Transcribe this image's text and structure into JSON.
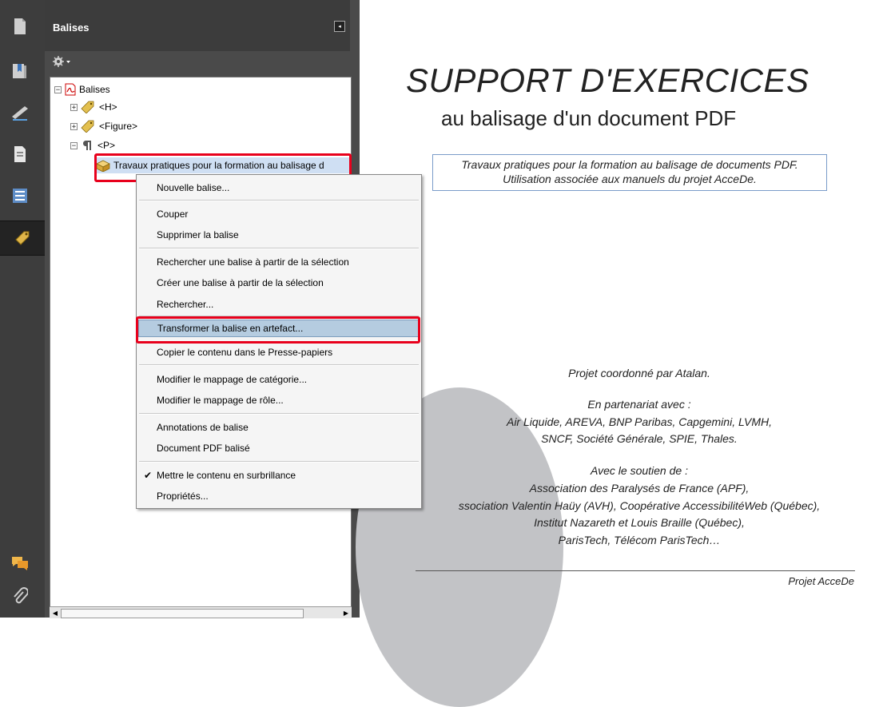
{
  "sidebar": {
    "tools": [
      {
        "name": "pages-icon"
      },
      {
        "name": "bookmarks-icon"
      },
      {
        "name": "signatures-icon"
      },
      {
        "name": "layers-icon"
      },
      {
        "name": "model-tree-icon"
      },
      {
        "name": "tags-icon",
        "active": true
      },
      {
        "name": "comments-icon"
      },
      {
        "name": "attachments-icon"
      }
    ]
  },
  "panel": {
    "title": "Balises",
    "collapse_glyph": "◂",
    "options_icon": "gear-icon",
    "tree": {
      "root": "Balises",
      "items": [
        "<H>",
        "<Figure>",
        "<P>"
      ],
      "selected": "Travaux pratiques pour la formation au balisage d"
    }
  },
  "context_menu": {
    "items": [
      {
        "label": "Nouvelle balise..."
      },
      {
        "label": "Couper"
      },
      {
        "label": "Supprimer la balise"
      },
      {
        "label": "Rechercher une balise à partir de la sélection"
      },
      {
        "label": "Créer une balise à partir de la sélection"
      },
      {
        "label": "Rechercher..."
      },
      {
        "label": "Transformer la balise en artefact...",
        "highlighted": true
      },
      {
        "label": "Copier le contenu dans le Presse-papiers"
      },
      {
        "label": "Modifier le mappage de catégorie..."
      },
      {
        "label": "Modifier le mappage de rôle..."
      },
      {
        "label": "Annotations de balise"
      },
      {
        "label": "Document PDF balisé"
      },
      {
        "label": "Mettre le contenu en surbrillance",
        "checked": true
      },
      {
        "label": "Propriétés..."
      }
    ]
  },
  "document": {
    "title": "SUPPORT D'EXERCICES",
    "subtitle": "au balisage d'un document PDF",
    "box_line1": "Travaux pratiques pour la formation au balisage de documents PDF.",
    "box_line2": "Utilisation associée aux manuels du projet AcceDe.",
    "coordinated": "Projet coordonné par Atalan.",
    "partnership_title": "En partenariat avec :",
    "partnership_line1": "Air Liquide, AREVA, BNP Paribas, Capgemini, LVMH,",
    "partnership_line2": "SNCF, Société Générale, SPIE, Thales.",
    "support_title": "Avec le soutien de :",
    "support_line1": "Association des Paralysés de France (APF),",
    "support_line2": "ssociation Valentin Haüy (AVH), Coopérative AccessibilitéWeb (Québec),",
    "support_line3": "Institut Nazareth et Louis Braille (Québec),",
    "support_line4": "ParisTech, Télécom ParisTech…",
    "footer": "Projet AcceDe"
  },
  "colors": {
    "highlight_box": "#e8001c",
    "menu_highlight": "#b5cce0",
    "toolbar": "#3d3d3d"
  }
}
